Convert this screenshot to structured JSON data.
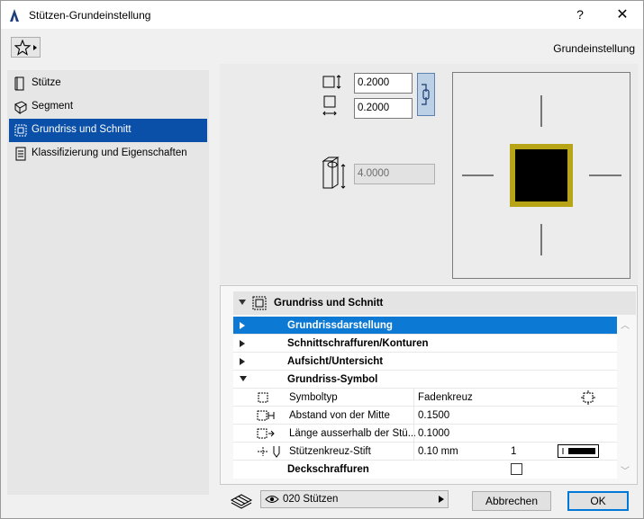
{
  "window": {
    "title": "Stützen-Grundeinstellung",
    "help": "?",
    "close": "✕"
  },
  "header": {
    "label": "Grundeinstellung"
  },
  "sidebar": {
    "items": [
      {
        "label": "Stütze"
      },
      {
        "label": "Segment"
      },
      {
        "label": "Grundriss und Schnitt",
        "selected": true
      },
      {
        "label": "Klassifizierung und Eigenschaften"
      }
    ]
  },
  "dimensions": {
    "width": "0.2000",
    "depth": "0.2000",
    "height": "4.0000"
  },
  "panel": {
    "title": "Grundriss und Schnitt",
    "groups": [
      {
        "label": "Grundrissdarstellung",
        "selected": true
      },
      {
        "label": "Schnittschraffuren/Konturen"
      },
      {
        "label": "Aufsicht/Untersicht"
      },
      {
        "label": "Grundriss-Symbol",
        "expanded": true
      }
    ],
    "params": [
      {
        "label": "Symboltyp",
        "value": "Fadenkreuz"
      },
      {
        "label": "Abstand von der Mitte",
        "value": "0.1500"
      },
      {
        "label": "Länge ausserhalb der Stü...",
        "value": "0.1000"
      },
      {
        "label": "Stützenkreuz-Stift",
        "value": "0.10 mm",
        "value2": "1"
      }
    ],
    "last_group": {
      "label": "Deckschraffuren"
    }
  },
  "footer": {
    "layer": "020 Stützen",
    "cancel": "Abbrechen",
    "ok": "OK"
  },
  "colors": {
    "accent": "#0a4fa8",
    "selection": "#0c79d4",
    "column_outline": "#b7a417"
  }
}
